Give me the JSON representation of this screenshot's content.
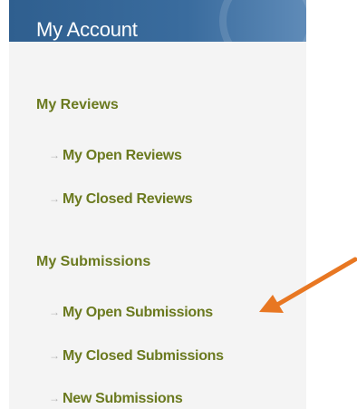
{
  "header": {
    "title": "My Account"
  },
  "sections": [
    {
      "title": "My Reviews",
      "items": [
        {
          "label": "My Open Reviews",
          "arrow": "→"
        },
        {
          "label": "My Closed Reviews",
          "arrow": "→"
        }
      ]
    },
    {
      "title": "My Submissions",
      "items": [
        {
          "label": "My Open Submissions",
          "arrow": "→"
        },
        {
          "label": "My Closed Submissions",
          "arrow": "→"
        },
        {
          "label": "New Submissions",
          "arrow": "→"
        }
      ]
    }
  ],
  "colors": {
    "header_bg": "#3a6c9e",
    "link_text": "#6b7a1f",
    "panel_bg": "#f4f4f4",
    "callout_arrow": "#e87722"
  },
  "annotation": {
    "icon": "orange-callout-arrow-icon",
    "points_to": "My Open Submissions"
  }
}
